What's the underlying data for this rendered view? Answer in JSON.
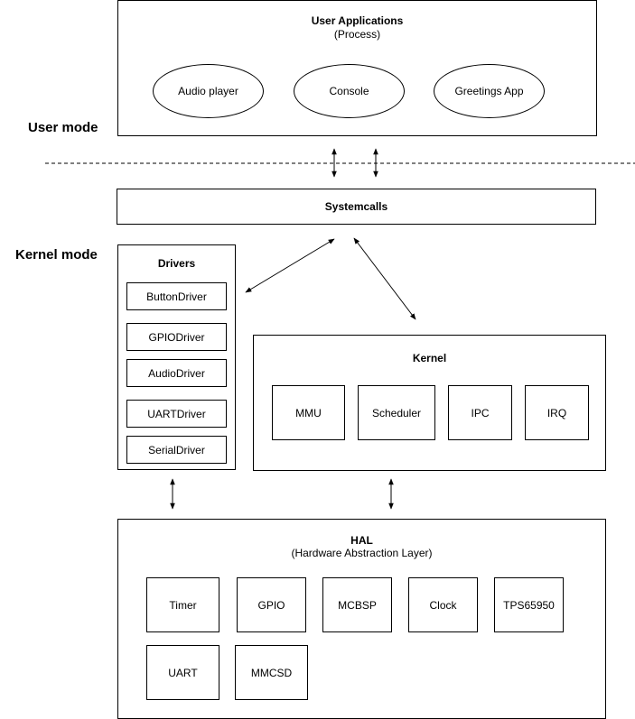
{
  "modes": {
    "user": "User mode",
    "kernel": "Kernel mode"
  },
  "user_applications": {
    "title": "User Applications",
    "subtitle": "(Process)",
    "apps": [
      "Audio player",
      "Console",
      "Greetings App"
    ]
  },
  "systemcalls": {
    "title": "Systemcalls"
  },
  "drivers": {
    "title": "Drivers",
    "items": [
      "ButtonDriver",
      "GPIODriver",
      "AudioDriver",
      "UARTDriver",
      "SerialDriver"
    ]
  },
  "kernel": {
    "title": "Kernel",
    "items": [
      "MMU",
      "Scheduler",
      "IPC",
      "IRQ"
    ]
  },
  "hal": {
    "title": "HAL",
    "subtitle": "(Hardware Abstraction Layer)",
    "row1": [
      "Timer",
      "GPIO",
      "MCBSP",
      "Clock",
      "TPS65950"
    ],
    "row2": [
      "UART",
      "MMCSD"
    ]
  },
  "connections": [
    {
      "from": "user-applications",
      "to": "systemcalls",
      "type": "bidirectional"
    },
    {
      "from": "user-applications",
      "to": "systemcalls",
      "type": "bidirectional"
    },
    {
      "from": "systemcalls",
      "to": "drivers",
      "type": "bidirectional"
    },
    {
      "from": "systemcalls",
      "to": "kernel",
      "type": "bidirectional"
    },
    {
      "from": "drivers",
      "to": "hal",
      "type": "bidirectional"
    },
    {
      "from": "kernel",
      "to": "hal",
      "type": "bidirectional"
    }
  ]
}
